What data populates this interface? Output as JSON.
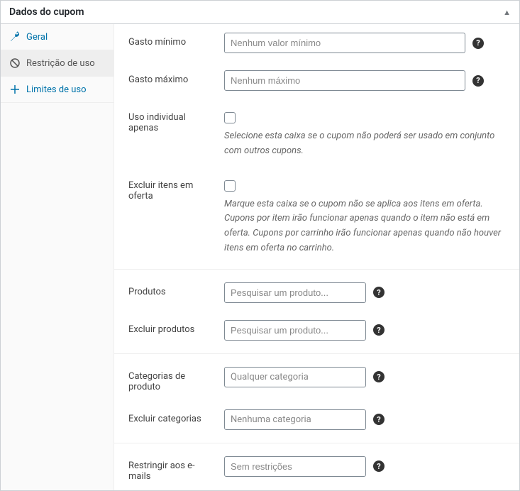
{
  "header": {
    "title": "Dados do cupom"
  },
  "sidebar": {
    "items": [
      {
        "label": "Geral"
      },
      {
        "label": "Restrição de uso"
      },
      {
        "label": "Limites de uso"
      }
    ]
  },
  "fields": {
    "min_spend": {
      "label": "Gasto mínimo",
      "placeholder": "Nenhum valor mínimo"
    },
    "max_spend": {
      "label": "Gasto máximo",
      "placeholder": "Nenhum máximo"
    },
    "individual_use": {
      "label": "Uso individual apenas",
      "desc": "Selecione esta caixa se o cupom não poderá ser usado em conjunto com outros cupons."
    },
    "exclude_sale": {
      "label": "Excluir itens em oferta",
      "desc": "Marque esta caixa se o cupom não se aplica aos itens em oferta. Cupons por item irão funcionar apenas quando o item não está em oferta. Cupons por carrinho irão funcionar apenas quando não houver itens em oferta no carrinho."
    },
    "products": {
      "label": "Produtos",
      "placeholder": "Pesquisar um produto..."
    },
    "exclude_products": {
      "label": "Excluir produtos",
      "placeholder": "Pesquisar um produto..."
    },
    "categories": {
      "label": "Categorias de produto",
      "placeholder": "Qualquer categoria"
    },
    "exclude_categories": {
      "label": "Excluir categorias",
      "placeholder": "Nenhuma categoria"
    },
    "restrict_emails": {
      "label": "Restringir aos e-mails",
      "placeholder": "Sem restrições"
    }
  },
  "help_symbol": "?"
}
